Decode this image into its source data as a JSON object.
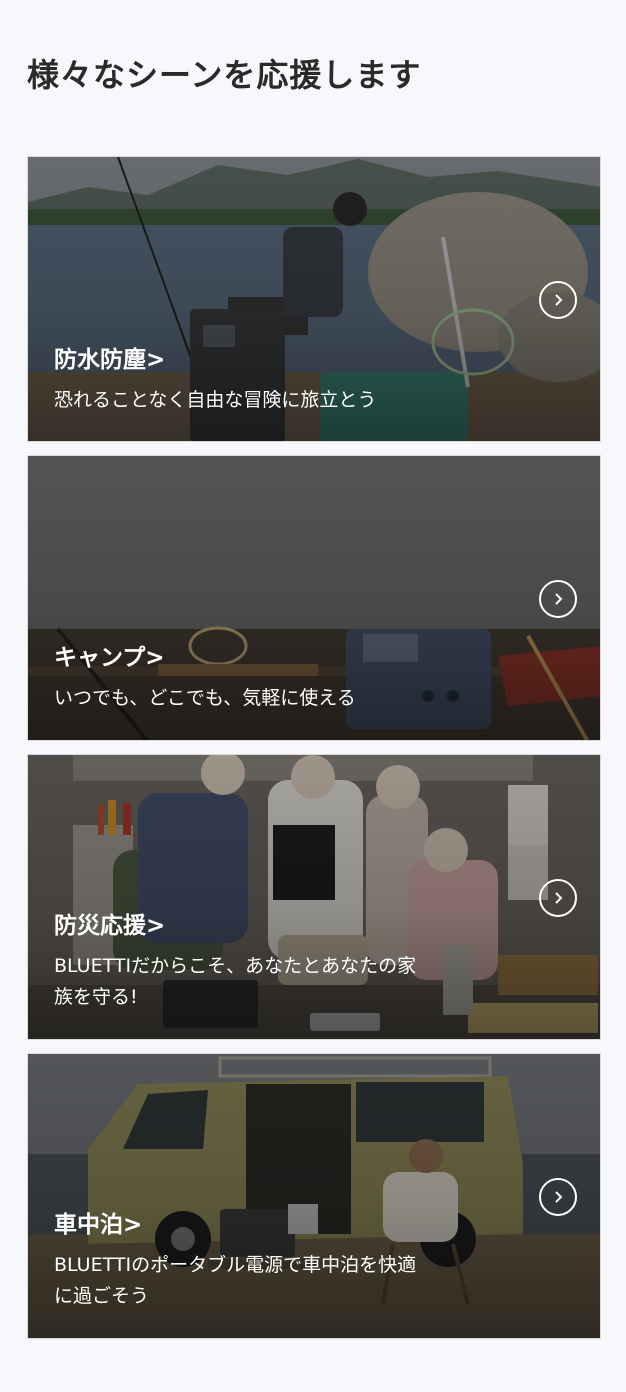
{
  "section": {
    "title": "様々なシーンを応援します"
  },
  "cards": [
    {
      "heading": "防水防塵>",
      "description": "恐れることなく自由な冒険に旅立とう"
    },
    {
      "heading": "キャンプ>",
      "description": "いつでも、どこでも、気軽に使える"
    },
    {
      "heading": "防災応援>",
      "description": "BLUETTIだからこそ、あなたとあなたの家族を守る!"
    },
    {
      "heading": "車中泊>",
      "description": "BLUETTIのポータブル電源で車中泊を快適に過ごそう"
    }
  ],
  "icons": {
    "card_arrow": "chevron-right-icon"
  },
  "colors": {
    "page_bg": "#f8f7fc",
    "title_text": "#2a2a2a",
    "card_text": "#ffffff"
  }
}
